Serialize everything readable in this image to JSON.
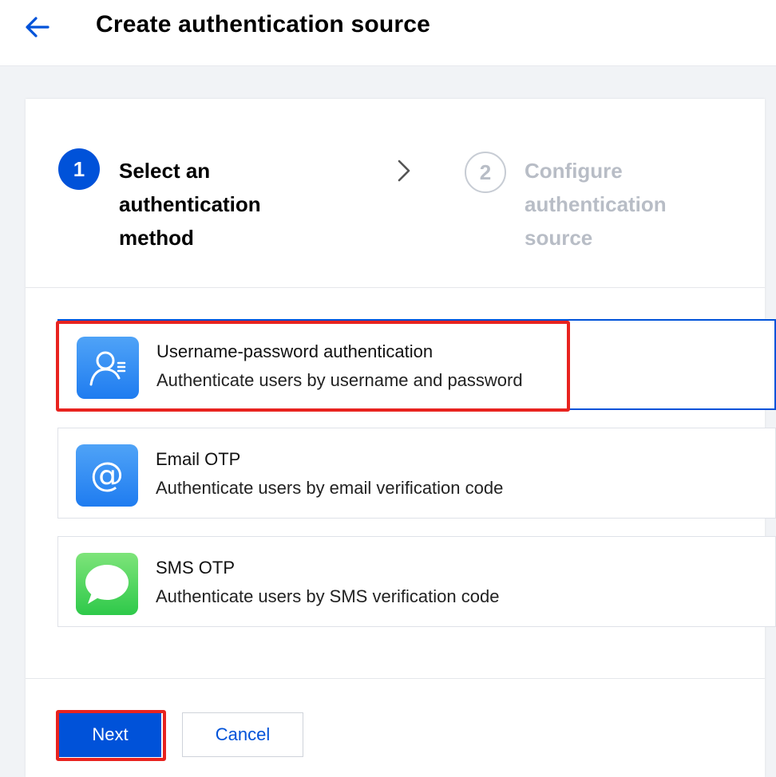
{
  "header": {
    "back_icon": "arrow-left-icon",
    "title": "Create authentication source"
  },
  "steps": [
    {
      "number": "1",
      "label": "Select an authentication method",
      "state": "active"
    },
    {
      "number": "2",
      "label": "Configure authentication source",
      "state": "inactive"
    }
  ],
  "step_separator_icon": "chevron-right-icon",
  "methods": [
    {
      "title": "Username-password authentication",
      "description": "Authenticate users by username and password",
      "icon": "user-password-icon",
      "selected": true
    },
    {
      "title": "Email OTP",
      "description": "Authenticate users by email verification code",
      "icon": "at-sign-icon",
      "selected": false
    },
    {
      "title": "SMS OTP",
      "description": "Authenticate users by SMS verification code",
      "icon": "message-bubble-icon",
      "selected": false
    }
  ],
  "footer": {
    "next_label": "Next",
    "cancel_label": "Cancel"
  },
  "colors": {
    "primary": "#0052d9",
    "highlight": "#e8231f",
    "inactive_step": "#b8bdc6",
    "sms_green": "#4cd964"
  }
}
